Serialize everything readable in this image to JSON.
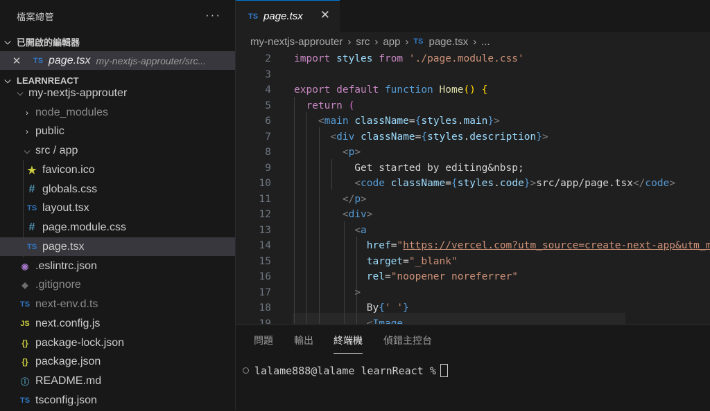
{
  "sidebar": {
    "title": "檔案總管",
    "more": "···",
    "open_editors": {
      "header": "已開啟的編輯器",
      "items": [
        {
          "close": "✕",
          "icon": "TS",
          "name": "page.tsx",
          "path": "my-nextjs-approuter/src..."
        }
      ]
    },
    "project": {
      "header": "LEARNREACT",
      "root": "my-nextjs-approuter",
      "items": [
        {
          "type": "folder",
          "name": "node_modules",
          "dim": true
        },
        {
          "type": "folder",
          "name": "public"
        },
        {
          "type": "folder-open",
          "name": "src / app"
        },
        {
          "type": "file",
          "icon": "★",
          "name": "favicon.ico"
        },
        {
          "type": "file",
          "icon": "#",
          "name": "globals.css"
        },
        {
          "type": "file",
          "icon": "TS",
          "name": "layout.tsx"
        },
        {
          "type": "file",
          "icon": "#",
          "name": "page.module.css"
        },
        {
          "type": "file",
          "icon": "TS",
          "name": "page.tsx",
          "selected": true
        },
        {
          "type": "file",
          "icon": "◉",
          "name": ".eslintrc.json"
        },
        {
          "type": "file",
          "icon": "◆",
          "name": ".gitignore",
          "dim": true
        },
        {
          "type": "file",
          "icon": "TS",
          "name": "next-env.d.ts",
          "dim": true
        },
        {
          "type": "file",
          "icon": "JS",
          "name": "next.config.js"
        },
        {
          "type": "file",
          "icon": "{}",
          "name": "package-lock.json"
        },
        {
          "type": "file",
          "icon": "{}",
          "name": "package.json"
        },
        {
          "type": "file",
          "icon": "ⓘ",
          "name": "README.md"
        },
        {
          "type": "file",
          "icon": "TS",
          "name": "tsconfig.json"
        }
      ]
    }
  },
  "tab": {
    "icon": "TS",
    "label": "page.tsx",
    "close": "✕"
  },
  "breadcrumb": {
    "parts": [
      "my-nextjs-approuter",
      "src",
      "app"
    ],
    "file_icon": "TS",
    "file": "page.tsx",
    "more": "..."
  },
  "code": [
    {
      "n": "2",
      "html": "<span class=\"kw\">import</span><span class=\"at\"> styles </span><span class=\"kw\">from</span><span class=\"tx\"> </span><span class=\"st\">'./page.module.css'</span>"
    },
    {
      "n": "3",
      "html": ""
    },
    {
      "n": "4",
      "html": "<span class=\"kw\">export default</span><span class=\"tx\"> </span><span class=\"kb\">function</span><span class=\"tx\"> </span><span class=\"fn\">Home</span><span class=\"yb\">()</span><span class=\"tx\"> </span><span class=\"yb\">{</span>"
    },
    {
      "n": "5",
      "html": "<span class=\"tx\">  </span><span class=\"kw\">return</span><span class=\"tx\"> </span><span class=\"pb\">(</span>"
    },
    {
      "n": "6",
      "html": "<span class=\"tx\">    </span><span class=\"br\">&lt;</span><span class=\"tg\">main</span><span class=\"tx\"> </span><span class=\"at\">className</span><span class=\"tx\">=</span><span class=\"kb\">{</span><span class=\"at\">styles</span><span class=\"tx\">.</span><span class=\"at\">main</span><span class=\"kb\">}</span><span class=\"br\">&gt;</span>"
    },
    {
      "n": "7",
      "html": "<span class=\"tx\">      </span><span class=\"br\">&lt;</span><span class=\"tg\">div</span><span class=\"tx\"> </span><span class=\"at\">className</span><span class=\"tx\">=</span><span class=\"kb\">{</span><span class=\"at\">styles</span><span class=\"tx\">.</span><span class=\"at\">description</span><span class=\"kb\">}</span><span class=\"br\">&gt;</span>"
    },
    {
      "n": "8",
      "html": "<span class=\"tx\">        </span><span class=\"br\">&lt;</span><span class=\"tg\">p</span><span class=\"br\">&gt;</span>"
    },
    {
      "n": "9",
      "html": "<span class=\"tx\">          Get started by editing&amp;nbsp;</span>"
    },
    {
      "n": "10",
      "html": "<span class=\"tx\">          </span><span class=\"br\">&lt;</span><span class=\"tg\">code</span><span class=\"tx\"> </span><span class=\"at\">className</span><span class=\"tx\">=</span><span class=\"kb\">{</span><span class=\"at\">styles</span><span class=\"tx\">.</span><span class=\"at\">code</span><span class=\"kb\">}</span><span class=\"br\">&gt;</span><span class=\"tx\">src/app/page.tsx</span><span class=\"br\">&lt;/</span><span class=\"tg\">code</span><span class=\"br\">&gt;</span>"
    },
    {
      "n": "11",
      "html": "<span class=\"tx\">        </span><span class=\"br\">&lt;/</span><span class=\"tg\">p</span><span class=\"br\">&gt;</span>"
    },
    {
      "n": "12",
      "html": "<span class=\"tx\">        </span><span class=\"br\">&lt;</span><span class=\"tg\">div</span><span class=\"br\">&gt;</span>"
    },
    {
      "n": "13",
      "html": "<span class=\"tx\">          </span><span class=\"br\">&lt;</span><span class=\"tg\">a</span>"
    },
    {
      "n": "14",
      "html": "<span class=\"tx\">            </span><span class=\"at\">href</span><span class=\"tx\">=</span><span class=\"st\">\"</span><span class=\"lnk\">https://vercel.com?utm_source=create-next-app&amp;utm_medium</span>"
    },
    {
      "n": "15",
      "html": "<span class=\"tx\">            </span><span class=\"at\">target</span><span class=\"tx\">=</span><span class=\"st\">\"_blank\"</span>"
    },
    {
      "n": "16",
      "html": "<span class=\"tx\">            </span><span class=\"at\">rel</span><span class=\"tx\">=</span><span class=\"st\">\"noopener noreferrer\"</span>"
    },
    {
      "n": "17",
      "html": "<span class=\"tx\">          </span><span class=\"br\">&gt;</span>"
    },
    {
      "n": "18",
      "html": "<span class=\"tx\">            By</span><span class=\"kb\">{</span><span class=\"st\">' '</span><span class=\"kb\">}</span>"
    },
    {
      "n": "19",
      "html": "<span class=\"tx\">            </span><span class=\"br\">&lt;</span><span class=\"tg\">Image</span>"
    }
  ],
  "panel": {
    "tabs": [
      "問題",
      "輸出",
      "終端機",
      "偵錯主控台"
    ],
    "active_tab": 2,
    "terminal_prompt": "lalame888@lalame learnReact %"
  }
}
